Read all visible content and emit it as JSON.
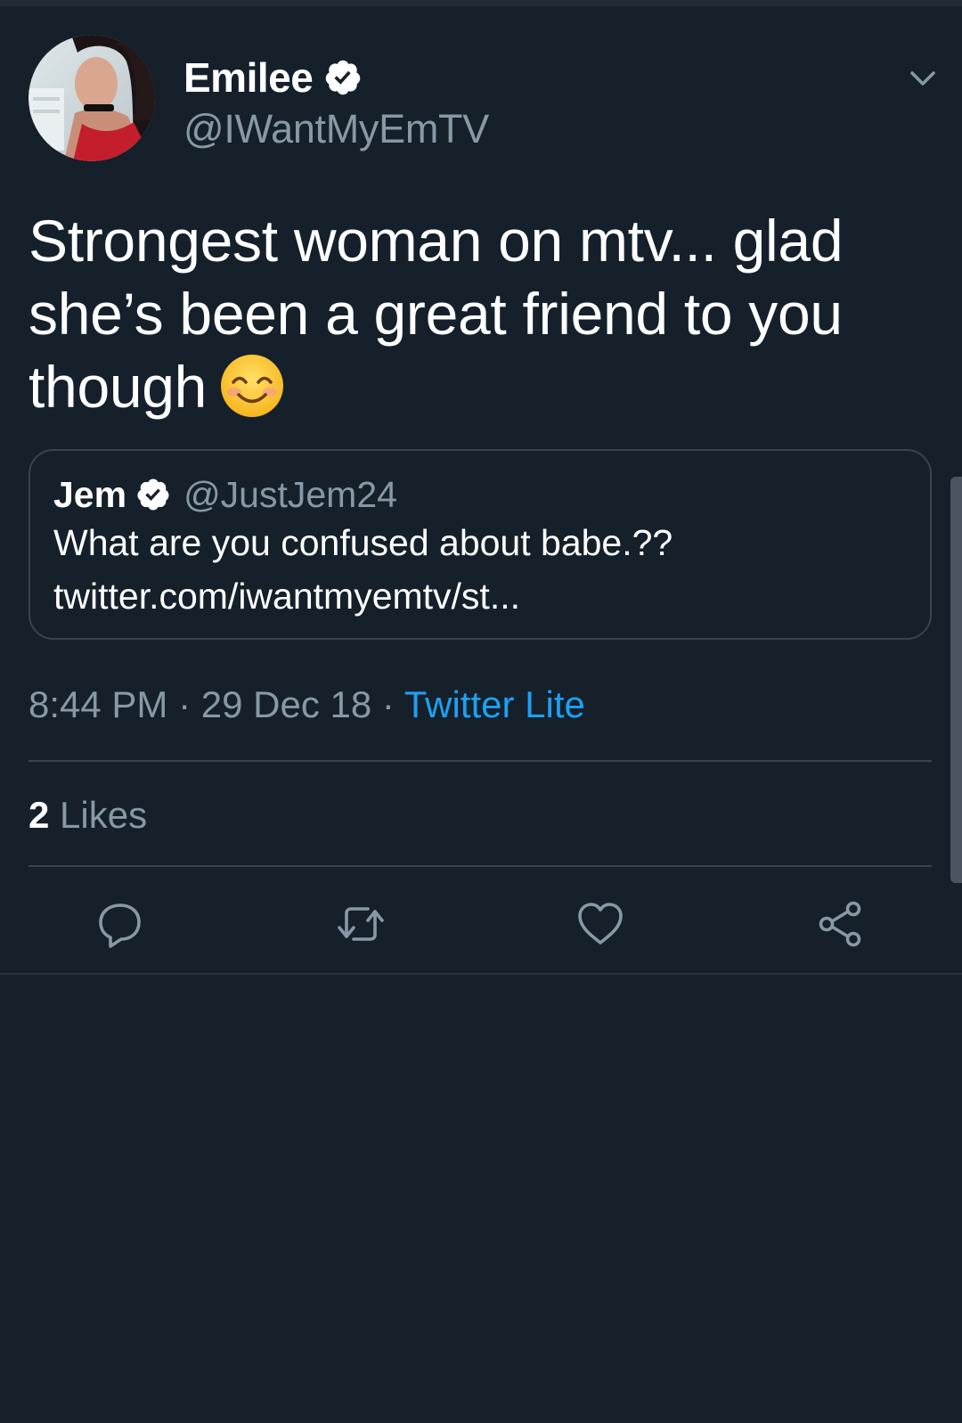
{
  "colors": {
    "background": "#15202b",
    "text_primary": "#ffffff",
    "text_secondary": "#8899a6",
    "accent": "#1da1f2",
    "border": "#38444d"
  },
  "tweet": {
    "author": {
      "name": "Emilee",
      "handle": "@IWantMyEmTV",
      "verified_icon": "verified-badge-icon",
      "avatar": "profile-photo"
    },
    "menu_icon": "chevron-down-icon",
    "text_line1": "Strongest woman on mtv... glad",
    "text_line2": "she’s been a great friend to you",
    "text_line3": "though",
    "emoji": "smiling-face-with-smiling-eyes",
    "quoted_tweet": {
      "name": "Jem",
      "handle": "@JustJem24",
      "verified_icon": "verified-badge-icon",
      "text": "What are you confused about babe.??",
      "link": "twitter.com/iwantmyemtv/st..."
    },
    "time": "8:44 PM",
    "separator": " · ",
    "date": "29 Dec 18",
    "source": "Twitter Lite",
    "likes_count": "2",
    "likes_label": " Likes",
    "actions": {
      "reply_icon": "reply-icon",
      "retweet_icon": "retweet-icon",
      "like_icon": "heart-icon",
      "share_icon": "share-icon"
    }
  }
}
